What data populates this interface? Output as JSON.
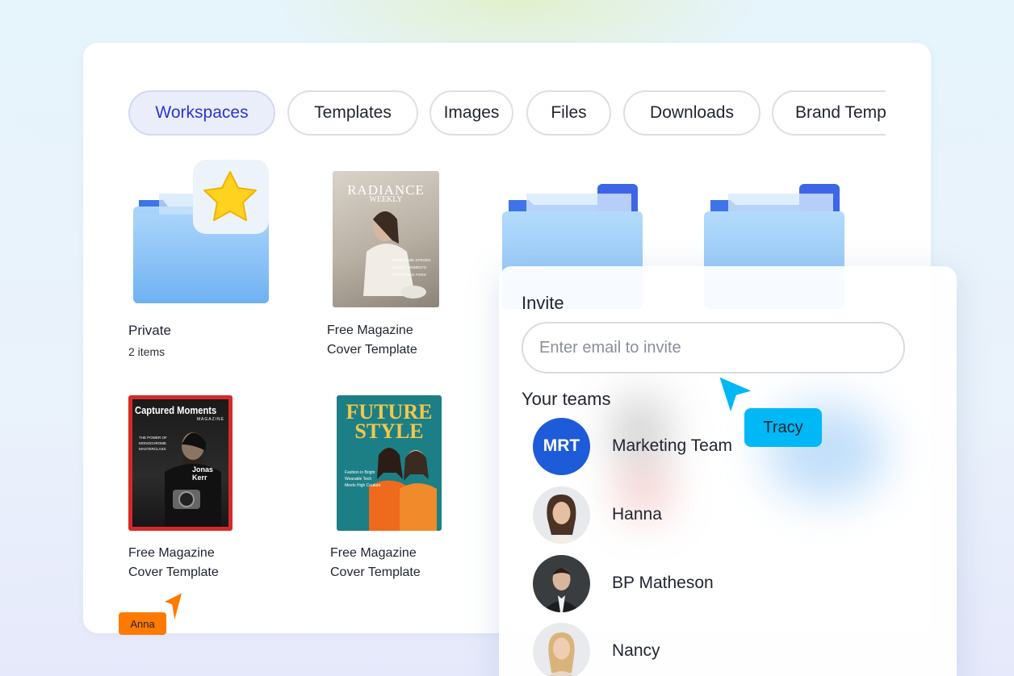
{
  "tabs": [
    {
      "label": "Workspaces",
      "active": true
    },
    {
      "label": "Templates",
      "active": false
    },
    {
      "label": "Images",
      "active": false
    },
    {
      "label": "Files",
      "active": false
    },
    {
      "label": "Downloads",
      "active": false
    },
    {
      "label": "Brand Templates",
      "active": false
    }
  ],
  "grid": {
    "private_folder": {
      "title": "Private",
      "count": "2 items",
      "icon": "star-folder-icon"
    },
    "radiance_template": {
      "title_line1": "Free Magazine",
      "title_line2": "Cover Template",
      "cover_masthead": "RADIANCE",
      "cover_sub": "WEEKLY",
      "cover_lines": [
        "GLOW GAME STRONG",
        "MAKEUP MOMENTS",
        "FRESH-FACE FIXES"
      ]
    },
    "captured_template": {
      "title_line1": "Free Magazine",
      "title_line2": "Cover Template",
      "cover_masthead": "Captured Moments",
      "cover_sub": "MAGAZINE",
      "cover_name": "Jonas Kerr",
      "cover_lines": [
        "THE POWER OF",
        "MONOCHROME",
        "MASTERCLASS"
      ]
    },
    "future_template": {
      "title_line1": "Free Magazine",
      "title_line2": "Cover Template",
      "cover_masthead_1": "FUTURE",
      "cover_masthead_2": "STYLE",
      "cover_lines": [
        "Fashion in Bright",
        "Wearable Tech",
        "Meets High Couture"
      ]
    }
  },
  "invite": {
    "title": "Invite",
    "email_placeholder": "Enter email to invite",
    "teams_title": "Your teams",
    "members": [
      {
        "name": "Marketing Team",
        "initials": "MRT"
      },
      {
        "name": "Hanna",
        "initials": ""
      },
      {
        "name": "BP Matheson",
        "initials": ""
      },
      {
        "name": "Nancy",
        "initials": ""
      }
    ]
  },
  "cursors": [
    {
      "name": "Tracy",
      "color": "#00b8f5"
    },
    {
      "name": "Anna",
      "color": "#ff7a00"
    }
  ],
  "colors": {
    "accent": "#2e35d1",
    "folder_blue": "#7ab8f5",
    "team_blue": "#1e5bd8"
  }
}
